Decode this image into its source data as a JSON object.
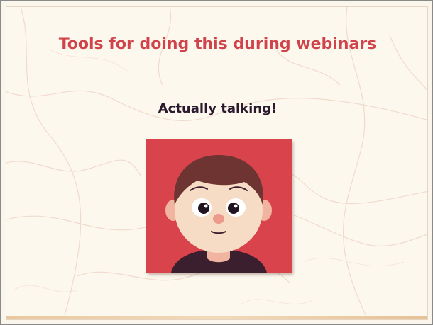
{
  "slide": {
    "title": "Tools for doing this during webinars",
    "subtitle": "Actually talking!"
  },
  "illustration": {
    "name": "person-avatar-icon",
    "description_colors": {
      "background": "#d9444c",
      "hair": "#6e3432",
      "skin": "#f6dcc4",
      "shirt": "#3b1f2e"
    }
  },
  "colors": {
    "title": "#d0434b",
    "subtitle": "#2b1a2d",
    "background": "#fdf8ee"
  }
}
